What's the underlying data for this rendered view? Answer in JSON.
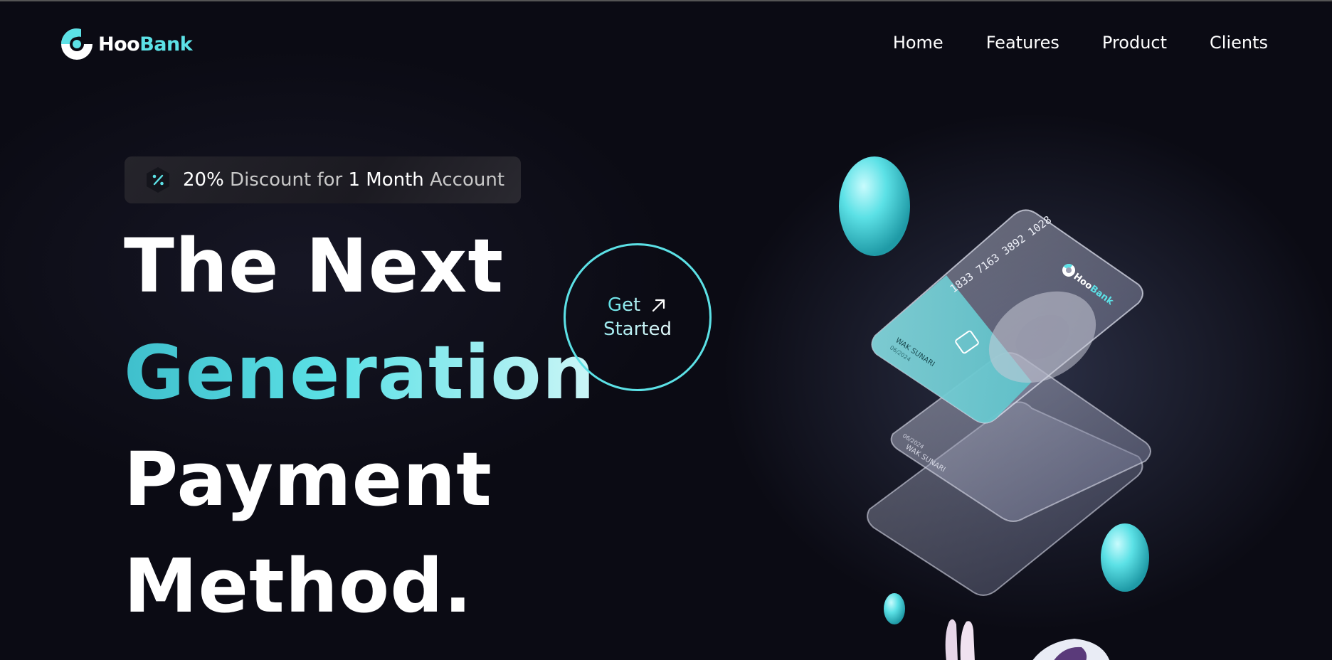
{
  "brand": {
    "name_part1": "Hoo",
    "name_part2": "Bank",
    "accent_color": "#5ce1e6",
    "logo_icon": "hoobank-logo-icon"
  },
  "nav": {
    "items": [
      {
        "label": "Home"
      },
      {
        "label": "Features"
      },
      {
        "label": "Product"
      },
      {
        "label": "Clients"
      }
    ]
  },
  "badge": {
    "icon": "discount-icon",
    "part1": "20%",
    "part2": " Discount for ",
    "part3": "1 Month",
    "part4": " Account"
  },
  "hero": {
    "line1": "The Next",
    "line2": "Generation",
    "line3": "Payment",
    "line4": "Method."
  },
  "cta": {
    "line1": "Get",
    "line2": "Started",
    "icon": "arrow-up-right-icon"
  },
  "card": {
    "number": "1833 7163 3892 1028",
    "holder": "WAK SUNARI",
    "expiry": "06/2024",
    "brand_part1": "Hoo",
    "brand_part2": "Bank"
  }
}
